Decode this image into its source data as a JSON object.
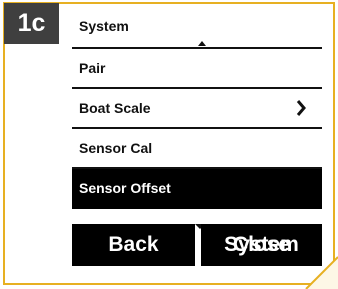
{
  "step_tag": "1c",
  "menu": {
    "items": [
      {
        "label": "System"
      },
      {
        "label": "Pair"
      },
      {
        "label": "Boat Scale"
      },
      {
        "label": "Sensor Cal"
      },
      {
        "label": "Sensor Offset"
      }
    ],
    "selected_index": 4
  },
  "softkeys": {
    "left_label": "Back",
    "right_label_a": "Close",
    "right_label_b": "System"
  },
  "colors": {
    "frame_accent": "#e7b022",
    "tag_bg": "#3f3f3f",
    "selected_bg": "#000000",
    "text": "#111111"
  },
  "icons": {
    "scroll_up": "scroll-up-icon",
    "scroll_down": "scroll-down-icon",
    "submenu": "chevron-right-icon"
  }
}
